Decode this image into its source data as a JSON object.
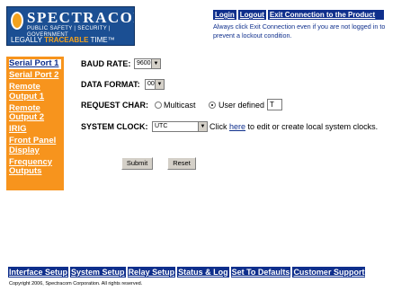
{
  "logo": {
    "name": "SPECTRACOM",
    "subtitle": "PUBLIC SAFETY | SECURITY | GOVERNMENT",
    "tagline_prefix": "LEGALLY",
    "tagline_highlight": "TRACEABLE",
    "tagline_suffix": "TIME™"
  },
  "top_links": {
    "login": "Login",
    "logout": "Logout",
    "exit": "Exit Connection to the Product"
  },
  "note": "Always click Exit Connection even if you are not logged in to prevent a lockout condition.",
  "sidebar": {
    "items": [
      {
        "label": "Serial Port 1"
      },
      {
        "label": "Serial Port 2"
      },
      {
        "label": "Remote Output 1"
      },
      {
        "label": "Remote Output 2"
      },
      {
        "label": "IRIG"
      },
      {
        "label": "Front Panel Display"
      },
      {
        "label": "Frequency Outputs"
      }
    ],
    "active_index": 0
  },
  "form": {
    "baud_rate": {
      "label": "BAUD RATE:",
      "value": "9600"
    },
    "data_format": {
      "label": "DATA FORMAT:",
      "value": "00"
    },
    "request_char": {
      "label": "REQUEST CHAR:",
      "option_multicast": "Multicast",
      "option_user_defined": "User defined",
      "selected": "User defined",
      "value": "T"
    },
    "system_clock": {
      "label": "SYSTEM CLOCK:",
      "value": "UTC",
      "help_prefix": "Click",
      "help_link": "here",
      "help_suffix": "to edit or create local system clocks."
    },
    "submit_label": "Submit",
    "reset_label": "Reset"
  },
  "bottom_nav": {
    "items": [
      {
        "label": "Interface Setup"
      },
      {
        "label": "System Setup"
      },
      {
        "label": "Relay Setup"
      },
      {
        "label": "Status & Log"
      },
      {
        "label": "Set To Defaults"
      },
      {
        "label": "Customer Support"
      }
    ]
  },
  "copyright": "Copyright 2006, Spectracom Corporation. All rights reserved.",
  "colors": {
    "nav_blue": "#0f2f8c",
    "sidebar_orange": "#f7941d",
    "logo_blue": "#1b4f93"
  }
}
